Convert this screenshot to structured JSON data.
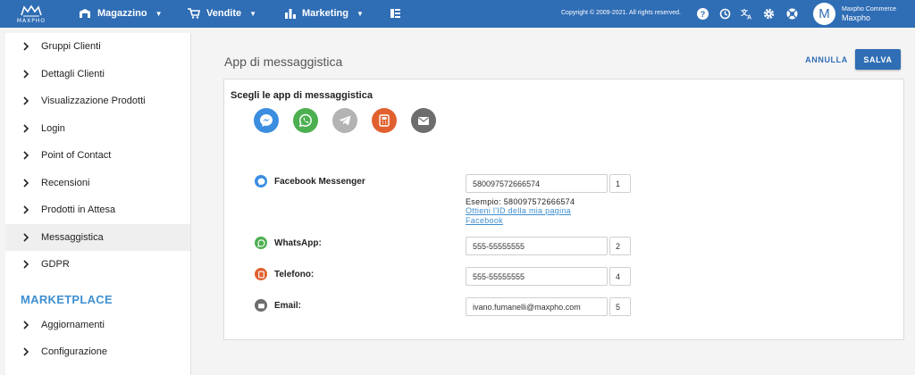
{
  "topbar": {
    "logo_text": "MAXPHO",
    "nav": [
      {
        "label": "Magazzino",
        "icon": "warehouse-icon"
      },
      {
        "label": "Vendite",
        "icon": "cart-icon"
      },
      {
        "label": "Marketing",
        "icon": "bar-chart-icon"
      }
    ],
    "copyright": "Copyright © 2009-2021. All rights reserved.",
    "icons": [
      "help-icon",
      "history-icon",
      "translate-icon",
      "settings-icon",
      "support-icon"
    ],
    "user": {
      "initial": "M",
      "company": "Maxpho Commerce",
      "name": "Maxpho"
    },
    "accent_color": "#2f6db5"
  },
  "sidebar": {
    "items": [
      {
        "label": "Gruppi Clienti"
      },
      {
        "label": "Dettagli Clienti"
      },
      {
        "label": "Visualizzazione Prodotti"
      },
      {
        "label": "Login"
      },
      {
        "label": "Point of Contact"
      },
      {
        "label": "Recensioni"
      },
      {
        "label": "Prodotti in Attesa"
      },
      {
        "label": "Messaggistica",
        "active": true
      },
      {
        "label": "GDPR"
      }
    ],
    "section": "MARKETPLACE",
    "section_items": [
      {
        "label": "Aggiornamenti"
      },
      {
        "label": "Configurazione"
      }
    ]
  },
  "main": {
    "title": "App di messaggistica",
    "cancel_label": "ANNULLA",
    "save_label": "SALVA",
    "card": {
      "heading": "Scegli le app di messaggistica",
      "apps": [
        {
          "icon": "messenger-icon",
          "color": "#3b8de0"
        },
        {
          "icon": "whatsapp-icon",
          "color": "#4caf50"
        },
        {
          "icon": "telegram-icon",
          "color": "#b3b3b3"
        },
        {
          "icon": "phone-icon",
          "color": "#e0612f"
        },
        {
          "icon": "email-icon",
          "color": "#6d6d6d"
        }
      ],
      "fields": [
        {
          "label": "Facebook Messenger",
          "value": "580097572666574",
          "order": "1",
          "icon": "messenger-icon",
          "color": "#3b8de0"
        },
        {
          "label": "WhatsApp:",
          "value": "555-55555555",
          "order": "2",
          "icon": "whatsapp-icon",
          "color": "#4caf50"
        },
        {
          "label": "Telefono:",
          "value": "555-55555555",
          "order": "4",
          "icon": "phone-icon",
          "color": "#e0612f"
        },
        {
          "label": "Email:",
          "value": "ivano.fumanelli@maxpho.com",
          "order": "5",
          "icon": "email-icon",
          "color": "#6d6d6d"
        }
      ],
      "example": "Esempio: 580097572666574",
      "help_link": "Ottieni l'ID della mia pagina Facebook"
    }
  }
}
